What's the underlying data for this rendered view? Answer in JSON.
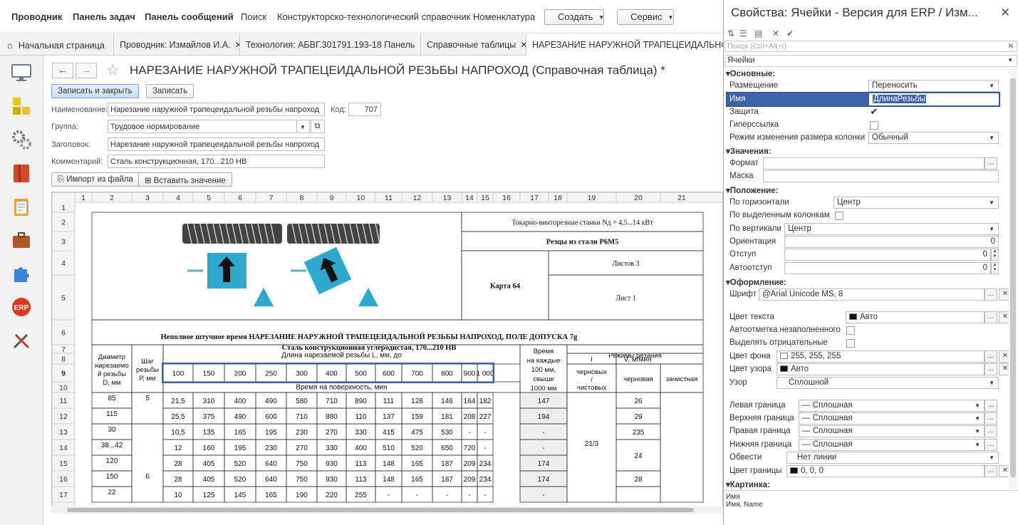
{
  "menu": {
    "items": [
      "Проводник",
      "Панель задач",
      "Панель сообщений",
      "Поиск",
      "Конструкторско-технологический справочник",
      "Номенклатура"
    ],
    "create_label": "Создать",
    "service_label": "Сервис"
  },
  "tabs": [
    {
      "label": "Начальная страница"
    },
    {
      "label": "Проводник: Измайлов И.А."
    },
    {
      "label": "Технология: АБВГ.301791.193-18 Панель"
    },
    {
      "label": "Справочные таблицы"
    },
    {
      "label": "НАРЕЗАНИЕ НАРУЖНОЙ ТРАПЕЦЕИДАЛЬНОЙ"
    }
  ],
  "doc": {
    "title": "НАРЕЗАНИЕ НАРУЖНОЙ ТРАПЕЦЕИДАЛЬНОЙ РЕЗЬБЫ НАПРОХОД (Справочная таблица) *",
    "save_close_label": "Записать и закрыть",
    "save_label": "Записать",
    "name_label": "Наименование:",
    "name_value": "Нарезание наружной трапецеидальной резьбы напроход",
    "code_label": "Код:",
    "code_value": "707",
    "group_label": "Группа:",
    "group_value": "Трудовое нормирование",
    "header_label": "Заголовок:",
    "header_value": "Нарезание наружной трапецеидальной резьбы напроход",
    "comment_label": "Комментарий:",
    "comment_value": "Сталь конструкционная, 170...210 НВ",
    "import_label": "Импорт из файла",
    "insert_label": "Вставить значение"
  },
  "sheet": {
    "col_headers": [
      "1",
      "2",
      "3",
      "4",
      "5",
      "6",
      "7",
      "8",
      "9",
      "10",
      "11",
      "12",
      "13",
      "14",
      "15",
      "16",
      "17",
      "18",
      "19",
      "20",
      "21"
    ],
    "row_headers": [
      "1",
      "2",
      "3",
      "4",
      "5",
      "6",
      "7",
      "8",
      "9",
      "10",
      "11",
      "12",
      "13",
      "14",
      "15",
      "16",
      "17"
    ],
    "machine": "Токарно-винторезные станки Nд = 4,5...14 кВт",
    "cutters": "Резцы из стали Р6М5",
    "sheets_count": "Листов 3",
    "card": "Карта 64",
    "sheet_no": "Лист 1",
    "table_title": "Неполное штучное время НАРЕЗАНИЕ НАРУЖНОЙ ТРАПЕЦЕИДАЛЬНОЙ РЕЗЬБЫ НАПРОХОД, ПОЛЕ ДОПУСКА 7g",
    "table_subtitle": "Сталь конструкционная углеродистая, 170...210 НВ",
    "h_diameter": [
      "Диаметр",
      "нарезаемо",
      "й резьбы",
      "D, мм"
    ],
    "h_step": [
      "Шаг",
      "резьбы",
      "Р, мм"
    ],
    "h_length": "Длина нарезаемой резьбы L, мм, до",
    "lengths": [
      "100",
      "150",
      "200",
      "250",
      "300",
      "400",
      "500",
      "600",
      "700",
      "800",
      "900",
      "1 000"
    ],
    "h_surface_time": "Время на поверхность, мин",
    "h_time_each": [
      "Время",
      "на каждые",
      "100 мм,",
      "свыше",
      "1000 мм"
    ],
    "h_modes": "Режимы резания",
    "h_i": "i",
    "h_v": "V, м/мин",
    "h_rough_finish": [
      "черновых",
      "/",
      "чистовых"
    ],
    "h_rough": "черновая",
    "h_finish": "зачистная",
    "rows": [
      {
        "d": "85",
        "p": "5",
        "vals": [
          "21,5",
          "310",
          "400",
          "490",
          "580",
          "710",
          "890",
          "111",
          "128",
          "146",
          "164",
          "182"
        ],
        "t": "147",
        "v": "26"
      },
      {
        "d": "115",
        "p": "",
        "vals": [
          "25,5",
          "375",
          "490",
          "600",
          "710",
          "880",
          "110",
          "137",
          "159",
          "181",
          "208",
          "227"
        ],
        "t": "194",
        "v": "29"
      },
      {
        "d": "30",
        "p": "",
        "vals": [
          "10,5",
          "135",
          "165",
          "195",
          "230",
          "270",
          "330",
          "415",
          "475",
          "530",
          "-",
          "-"
        ],
        "t": "-",
        "v": "235"
      },
      {
        "d": "38...42",
        "p": "",
        "vals": [
          "12",
          "160",
          "195",
          "230",
          "270",
          "330",
          "400",
          "510",
          "520",
          "650",
          "720",
          "-"
        ],
        "t": "-",
        "v": ""
      },
      {
        "d": "120",
        "p": "",
        "vals": [
          "28",
          "405",
          "520",
          "640",
          "750",
          "930",
          "113",
          "148",
          "165",
          "187",
          "209",
          "234"
        ],
        "t": "174",
        "v": ""
      },
      {
        "d": "150",
        "p": "6",
        "vals": [
          "28",
          "405",
          "520",
          "640",
          "750",
          "930",
          "113",
          "148",
          "165",
          "187",
          "209",
          "234"
        ],
        "t": "174",
        "v": "28"
      },
      {
        "d": "22",
        "p": "",
        "vals": [
          "10",
          "125",
          "145",
          "165",
          "190",
          "220",
          "255",
          "-",
          "-",
          "-",
          "-",
          "-"
        ],
        "t": "-",
        "v": ""
      }
    ],
    "i_merged": "21/3",
    "v_merged": "24"
  },
  "panel": {
    "title": "Свойства: Ячейки - Версия для ERP / Изм...",
    "search_placeholder": "Поиск (Ctrl+Alt+I)",
    "object": "Ячейки",
    "s_basic": "Основные:",
    "placement_label": "Размещение",
    "placement_value": "Переносить",
    "name_label": "Имя",
    "name_value": "ДлинаРезьбы",
    "protect_label": "Защита",
    "hyperlink_label": "Гиперссылка",
    "resize_label": "Режим изменения размера колонки",
    "resize_value": "Обычный",
    "s_values": "Значения:",
    "format_label": "Формат",
    "mask_label": "Маска",
    "s_position": "Положение:",
    "horiz_label": "По горизонтали",
    "horiz_value": "Центр",
    "selcols_label": "По выделенным колонкам",
    "vert_label": "По вертикали",
    "vert_value": "Центр",
    "orient_label": "Ориентация",
    "orient_value": "0",
    "indent_label": "Отступ",
    "indent_value": "0",
    "autoindent_label": "Автоотступ",
    "autoindent_value": "0",
    "s_design": "Оформление:",
    "font_label": "Шрифт",
    "font_value": "@Arial Unicode MS, 8",
    "textcolor_label": "Цвет текста",
    "textcolor_value": "Авто",
    "automark_label": "Автоотметка незаполненного",
    "negative_label": "Выделять отрицательные",
    "bgcolor_label": "Цвет фона",
    "bgcolor_value": "255, 255, 255",
    "patterncolor_label": "Цвет узора",
    "patterncolor_value": "Авто",
    "pattern_label": "Узор",
    "pattern_value": "Сплошной",
    "left_border_label": "Левая граница",
    "top_border_label": "Верхняя граница",
    "right_border_label": "Правая граница",
    "bottom_border_label": "Нижняя граница",
    "border_value": "— Сплошная",
    "outline_label": "Обвести",
    "outline_value": "Нет линии",
    "bordercolor_label": "Цвет границы",
    "bordercolor_value": "0, 0, 0",
    "s_picture": "Картинка:",
    "footer_title": "Имя",
    "footer_desc": "Имя, Name",
    "colors": {
      "selection": "#3f63a8",
      "accent": "#c9dcf2"
    }
  }
}
